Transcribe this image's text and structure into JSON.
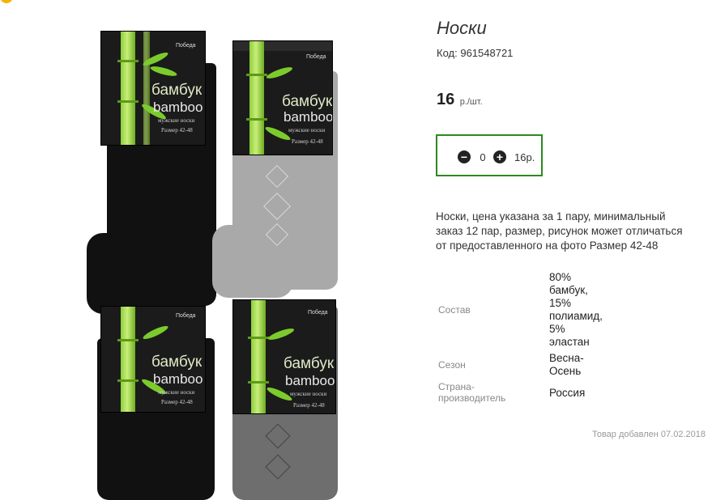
{
  "product": {
    "title": "Носки",
    "code_label": "Код:",
    "code_value": "961548721",
    "price_value": "16",
    "price_unit": "р./шт."
  },
  "quantity": {
    "minus_icon": "minus-circle-icon",
    "plus_icon": "plus-circle-icon",
    "value": "0",
    "sum": "16р."
  },
  "description": "Носки, цена указана за 1 пару, минимальный заказ 12 пар, размер, рисунок может отличаться от предоставленного на фото Размер 42-48",
  "specs": [
    {
      "label": "Состав",
      "value": "80% бамбук, 15% полиамид, 5% эластан"
    },
    {
      "label": "Сезон",
      "value": "Весна-Осень"
    },
    {
      "label": "Страна-производитель",
      "value": "Россия"
    }
  ],
  "spec_value_lines": {
    "composition": [
      "80%",
      "бамбук,",
      "15%",
      "полиамид,",
      "5%",
      "эластан"
    ],
    "season": [
      "Весна-",
      "Осень"
    ],
    "country": [
      "Россия"
    ]
  },
  "spec_label_lines": {
    "country": [
      "Страна-",
      "производитель"
    ]
  },
  "added": "Товар добавлен 07.02.2018",
  "photo_cards": {
    "logo": "Победа",
    "brand_ru": "бамбук",
    "brand_en": "bamboo",
    "subtitle": "мужские носки",
    "size": "Размер 42-48"
  },
  "colors": {
    "accent_border": "#2c8a1e",
    "bamboo_green": "#8ccf3a"
  }
}
